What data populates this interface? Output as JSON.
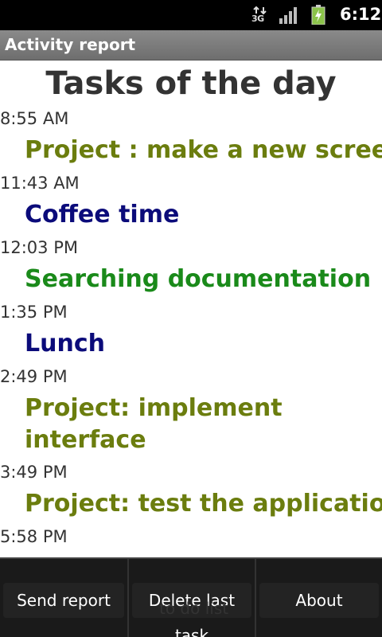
{
  "status_bar": {
    "network": "3G",
    "time": "6:12",
    "icons": [
      "3g-icon",
      "signal-icon",
      "battery-charging-icon"
    ]
  },
  "app": {
    "title": "Activity report"
  },
  "report": {
    "heading": "Tasks of the day",
    "entries": [
      {
        "time": "8:55 AM",
        "task": "Project : make a new screen",
        "color": "#6b7d0e"
      },
      {
        "time": "11:43 AM",
        "task": "Coffee time",
        "color": "#0b0b7a"
      },
      {
        "time": "12:03 PM",
        "task": "Searching documentation",
        "color": "#1a8a1a"
      },
      {
        "time": "1:35 PM",
        "task": "Lunch",
        "color": "#0b0b7a"
      },
      {
        "time": "2:49 PM",
        "task": "Project: implement interface",
        "color": "#6b7d0e"
      },
      {
        "time": "3:49 PM",
        "task": "Project: test the application",
        "color": "#6b7d0e"
      },
      {
        "time": "5:58 PM",
        "task": "",
        "color": "#6b7d0e"
      }
    ]
  },
  "menu": {
    "send_report": "Send report",
    "delete_last_task": "Delete last task",
    "about": "About",
    "obscured_text": "to do list"
  }
}
